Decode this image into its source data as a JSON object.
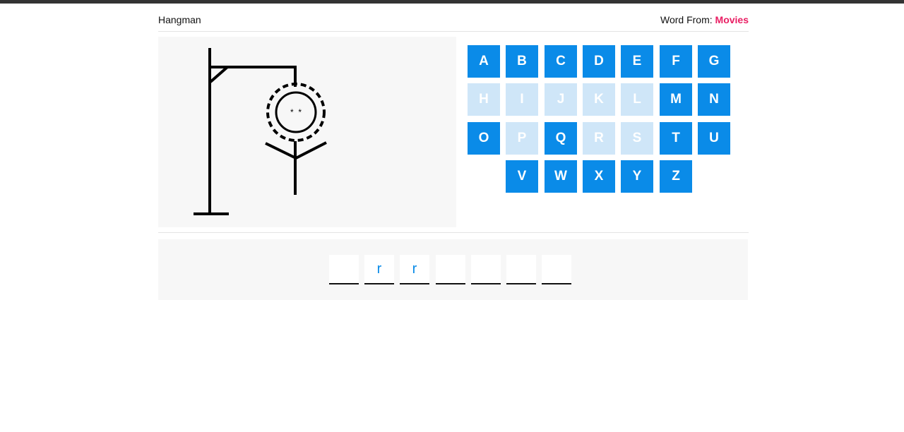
{
  "colors": {
    "accent": "#0a8be8",
    "accent_used": "#cfe6f8",
    "category": "#e91e63"
  },
  "header": {
    "title": "Hangman",
    "source_label": "Word From:",
    "category": "Movies"
  },
  "hangman": {
    "parts_drawn": [
      "gallows",
      "head",
      "eyes",
      "arms",
      "body"
    ],
    "eyes": "*  *"
  },
  "keyboard": {
    "rows": [
      [
        {
          "letter": "A",
          "used": false
        },
        {
          "letter": "B",
          "used": false
        },
        {
          "letter": "C",
          "used": false
        },
        {
          "letter": "D",
          "used": false
        },
        {
          "letter": "E",
          "used": false
        },
        {
          "letter": "F",
          "used": false
        },
        {
          "letter": "G",
          "used": false
        }
      ],
      [
        {
          "letter": "H",
          "used": true
        },
        {
          "letter": "I",
          "used": true
        },
        {
          "letter": "J",
          "used": true
        },
        {
          "letter": "K",
          "used": true
        },
        {
          "letter": "L",
          "used": true
        },
        {
          "letter": "M",
          "used": false
        },
        {
          "letter": "N",
          "used": false
        }
      ],
      [
        {
          "letter": "O",
          "used": false
        },
        {
          "letter": "P",
          "used": true
        },
        {
          "letter": "Q",
          "used": false
        },
        {
          "letter": "R",
          "used": true
        },
        {
          "letter": "S",
          "used": true
        },
        {
          "letter": "T",
          "used": false
        },
        {
          "letter": "U",
          "used": false
        }
      ],
      [
        {
          "letter": "V",
          "used": false
        },
        {
          "letter": "W",
          "used": false
        },
        {
          "letter": "X",
          "used": false
        },
        {
          "letter": "Y",
          "used": false
        },
        {
          "letter": "Z",
          "used": false
        }
      ]
    ]
  },
  "word": {
    "slots": [
      "",
      "r",
      "r",
      "",
      "",
      "",
      ""
    ]
  }
}
